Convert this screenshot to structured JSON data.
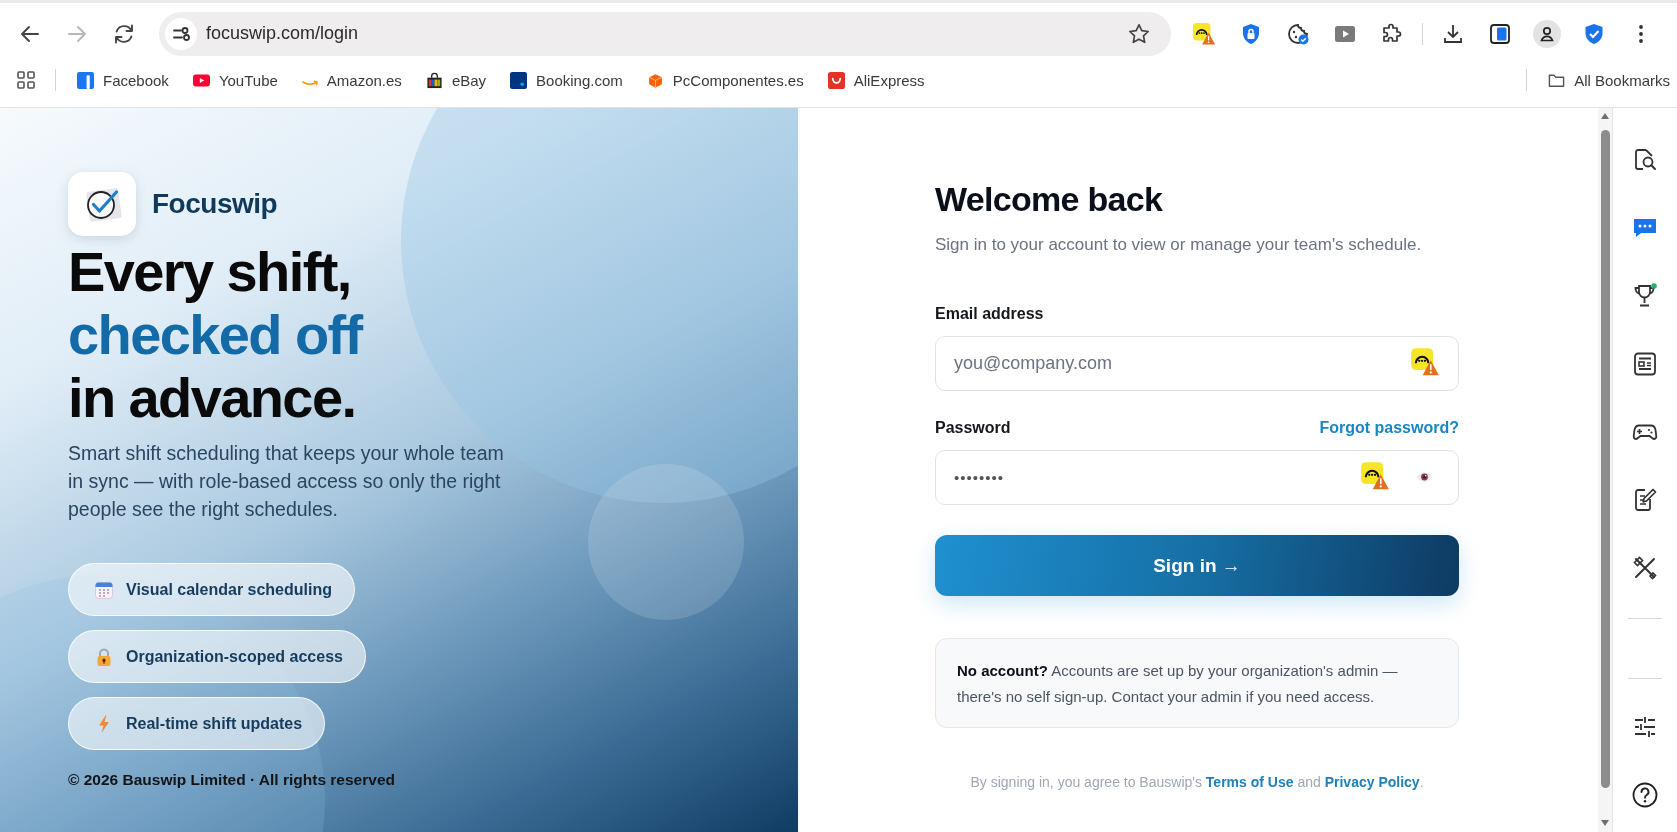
{
  "browser": {
    "nav": [
      {
        "kind": "back",
        "disabled": false
      },
      {
        "kind": "forward",
        "disabled": true
      },
      {
        "kind": "reload",
        "disabled": false
      }
    ],
    "url": "focuswip.com/login",
    "bookmarks": [
      {
        "label": "Facebook"
      },
      {
        "label": "YouTube"
      },
      {
        "label": "Amazon.es"
      },
      {
        "label": "eBay"
      },
      {
        "label": "Booking.com"
      },
      {
        "label": "PcComponentes.es"
      },
      {
        "label": "AliExpress"
      }
    ],
    "all_bookmarks": "All Bookmarks"
  },
  "hero": {
    "brand": "Focuswip",
    "headline": [
      {
        "text": "Every shift,",
        "accent": false
      },
      {
        "text": "checked off",
        "accent": true
      },
      {
        "text": "in advance.",
        "accent": false
      }
    ],
    "description": "Smart shift scheduling that keeps your whole team in sync — with role-based access so only the right people see the right schedules.",
    "features": [
      {
        "kind": "calendar",
        "label": "Visual calendar scheduling"
      },
      {
        "kind": "lock",
        "label": "Organization-scoped access"
      },
      {
        "kind": "bolt",
        "label": "Real-time shift updates"
      }
    ],
    "copyright": "© 2026 Bauswip Limited · All rights reserved"
  },
  "login": {
    "title": "Welcome back",
    "subtitle": "Sign in to your account to view or manage your team's schedule.",
    "fields": [
      {
        "kind": "email",
        "label": "Email address",
        "placeholder": "you@company.com"
      },
      {
        "kind": "password",
        "label": "Password",
        "value": "••••••••",
        "link": "Forgot password?"
      }
    ],
    "submit": "Sign in →",
    "notice": "**No account?** Accounts are set up by your organization's admin — there's no self sign-up. Contact your admin if you need access.",
    "legal": [
      {
        "kind": "text",
        "text": "By signing in, you agree to Bauswip's "
      },
      {
        "kind": "link",
        "text": "Terms of Use"
      },
      {
        "kind": "text",
        "text": " and "
      },
      {
        "kind": "link",
        "text": "Privacy Policy"
      },
      {
        "kind": "text",
        "text": "."
      }
    ]
  }
}
